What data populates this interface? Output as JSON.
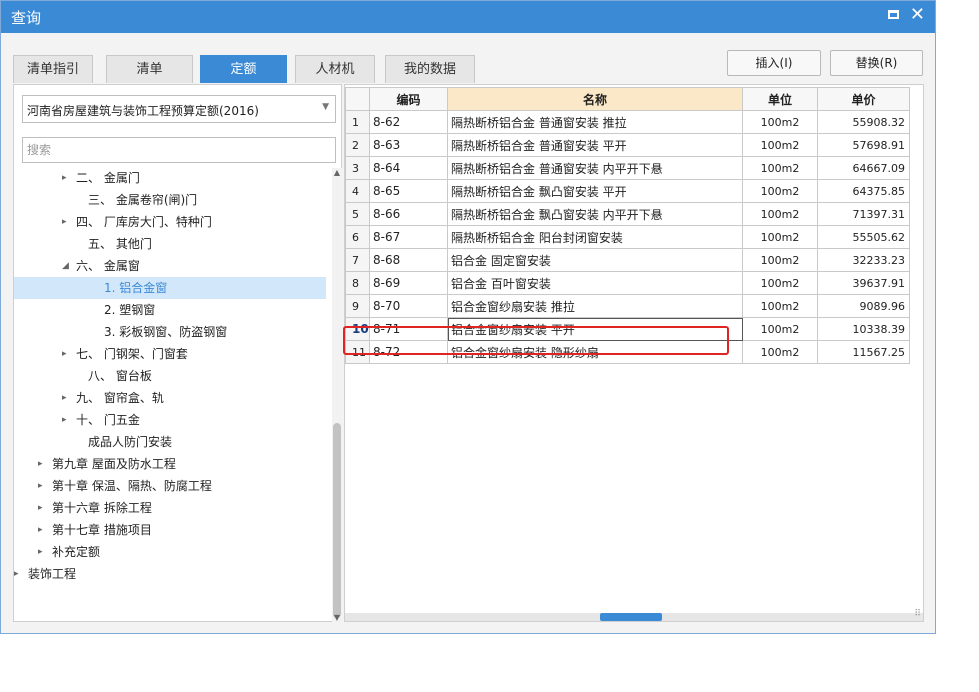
{
  "window": {
    "title": "查询"
  },
  "tabs": [
    {
      "label": "清单指引"
    },
    {
      "label": "清单"
    },
    {
      "label": "定额"
    },
    {
      "label": "人材机"
    },
    {
      "label": "我的数据"
    }
  ],
  "buttons": {
    "insert": "插入(I)",
    "replace": "替换(R)"
  },
  "left": {
    "quota_select": "河南省房屋建筑与装饰工程预算定额(2016)",
    "search_placeholder": "搜索",
    "tree": [
      {
        "label": "二、 金属门",
        "caret": "▸"
      },
      {
        "label": "三、 金属卷帘(闸)门",
        "caret": ""
      },
      {
        "label": "四、 厂库房大门、特种门",
        "caret": "▸"
      },
      {
        "label": "五、 其他门",
        "caret": ""
      },
      {
        "label": "六、 金属窗",
        "caret": "◢"
      },
      {
        "label": "1. 铝合金窗",
        "caret": ""
      },
      {
        "label": "2. 塑钢窗",
        "caret": ""
      },
      {
        "label": "3. 彩板钢窗、防盗钢窗",
        "caret": ""
      },
      {
        "label": "七、 门钢架、门窗套",
        "caret": "▸"
      },
      {
        "label": "八、 窗台板",
        "caret": ""
      },
      {
        "label": "九、 窗帘盒、轨",
        "caret": "▸"
      },
      {
        "label": "十、 门五金",
        "caret": "▸"
      },
      {
        "label": "成品人防门安装",
        "caret": ""
      },
      {
        "label": "第九章 屋面及防水工程",
        "caret": "▸"
      },
      {
        "label": "第十章 保温、隔热、防腐工程",
        "caret": "▸"
      },
      {
        "label": "第十六章 拆除工程",
        "caret": "▸"
      },
      {
        "label": "第十七章 措施项目",
        "caret": "▸"
      },
      {
        "label": "补充定额",
        "caret": "▸"
      },
      {
        "label": "装饰工程",
        "caret": "▸"
      }
    ]
  },
  "grid": {
    "headers": {
      "code": "编码",
      "name": "名称",
      "unit": "单位",
      "price": "单价"
    },
    "rows": [
      {
        "n": "1",
        "code": "8-62",
        "name": "隔热断桥铝合金 普通窗安装 推拉",
        "unit": "100m2",
        "price": "55908.32"
      },
      {
        "n": "2",
        "code": "8-63",
        "name": "隔热断桥铝合金 普通窗安装 平开",
        "unit": "100m2",
        "price": "57698.91"
      },
      {
        "n": "3",
        "code": "8-64",
        "name": "隔热断桥铝合金 普通窗安装 内平开下悬",
        "unit": "100m2",
        "price": "64667.09"
      },
      {
        "n": "4",
        "code": "8-65",
        "name": "隔热断桥铝合金 飘凸窗安装 平开",
        "unit": "100m2",
        "price": "64375.85"
      },
      {
        "n": "5",
        "code": "8-66",
        "name": "隔热断桥铝合金 飘凸窗安装 内平开下悬",
        "unit": "100m2",
        "price": "71397.31"
      },
      {
        "n": "6",
        "code": "8-67",
        "name": "隔热断桥铝合金 阳台封闭窗安装",
        "unit": "100m2",
        "price": "55505.62"
      },
      {
        "n": "7",
        "code": "8-68",
        "name": "铝合金 固定窗安装",
        "unit": "100m2",
        "price": "32233.23"
      },
      {
        "n": "8",
        "code": "8-69",
        "name": "铝合金 百叶窗安装",
        "unit": "100m2",
        "price": "39637.91"
      },
      {
        "n": "9",
        "code": "8-70",
        "name": "铝合金窗纱扇安装 推拉",
        "unit": "100m2",
        "price": "9089.96"
      },
      {
        "n": "10",
        "code": "8-71",
        "name": "铝合金窗纱扇安装 平开",
        "unit": "100m2",
        "price": "10338.39"
      },
      {
        "n": "11",
        "code": "8-72",
        "name": "铝合金窗纱扇安装 隐形纱扇",
        "unit": "100m2",
        "price": "11567.25"
      }
    ]
  },
  "colors": {
    "accent": "#3b8ad6",
    "highlight": "#e02424",
    "selection": "#d3e7fb",
    "name_header": "#fbe8c8"
  }
}
